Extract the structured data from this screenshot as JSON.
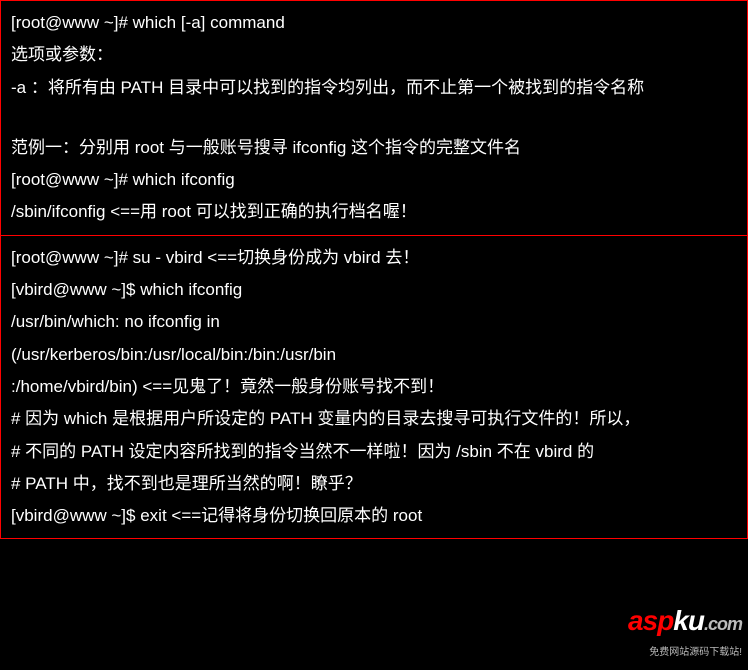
{
  "top": {
    "l1": "[root@www ~]# which [-a] command",
    "l2": "选项或参数：",
    "l3": "-a ：将所有由 PATH 目录中可以找到的指令均列出，而不止第一个被找到的指令名称",
    "l4": "范例一：分别用 root 与一般账号搜寻 ifconfig 这个指令的完整文件名",
    "l5": "[root@www ~]# which ifconfig",
    "l6": "/sbin/ifconfig            <==用 root 可以找到正确的执行档名喔！"
  },
  "bottom": {
    "l1": "[root@www ~]# su - vbird <==切换身份成为 vbird 去！",
    "l2": "[vbird@www ~]$ which ifconfig",
    "l3": "/usr/bin/which: no ifconfig in",
    "l4": "(/usr/kerberos/bin:/usr/local/bin:/bin:/usr/bin",
    "l5": ":/home/vbird/bin)        <==见鬼了！竟然一般身份账号找不到！",
    "l6": "# 因为 which 是根据用户所设定的 PATH 变量内的目录去搜寻可执行文件的！所以，",
    "l7": "# 不同的 PATH 设定内容所找到的指令当然不一样啦！因为 /sbin 不在 vbird 的",
    "l8": "# PATH 中，找不到也是理所当然的啊！瞭乎？",
    "l9": "[vbird@www ~]$ exit      <==记得将身份切换回原本的 root"
  },
  "watermark": {
    "brand_a": "asp",
    "brand_b": "ku",
    "tld": ".com",
    "tagline": "免费网站源码下载站!"
  }
}
